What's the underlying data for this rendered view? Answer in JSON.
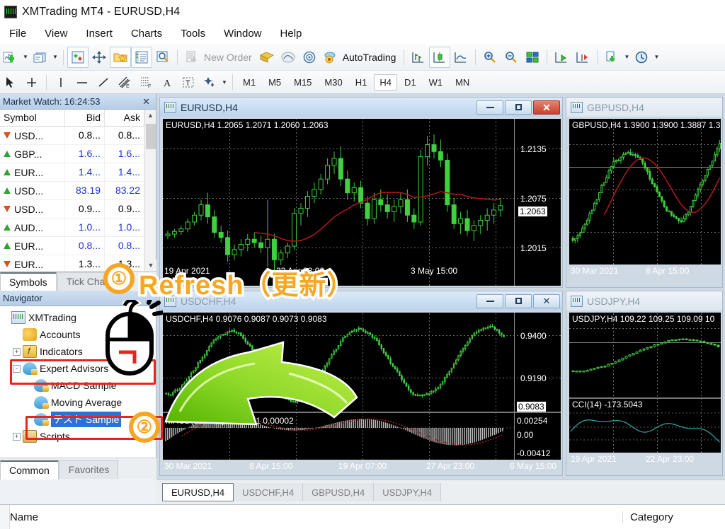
{
  "window": {
    "title": "XMTrading MT4 - EURUSD,H4",
    "app_icon": "mt4-icon"
  },
  "menu": {
    "items": [
      "File",
      "View",
      "Insert",
      "Charts",
      "Tools",
      "Window",
      "Help"
    ]
  },
  "toolbar": {
    "new_order_label": "New Order",
    "autotrading_label": "AutoTrading",
    "icons": [
      "new-chart-icon",
      "profiles-icon",
      "indicators-icon",
      "crosshair-icon",
      "favorites-icon",
      "market-watch-icon",
      "data-window-icon",
      "new-order-icon",
      "terminal-icon",
      "strategy-tester-icon",
      "metaeditor-icon",
      "autotrading-icon",
      "bar-chart-icon",
      "candlestick-chart-icon",
      "line-chart-icon",
      "zoom-in-icon",
      "zoom-out-icon",
      "tile-windows-icon",
      "chart-shift-icon",
      "auto-scroll-icon",
      "templates-icon",
      "period-icon"
    ],
    "line_tools": [
      "cursor-icon",
      "crosshair-icon",
      "vertical-line-icon",
      "horizontal-line-icon",
      "trendline-icon",
      "equidistant-channel-icon",
      "fibonacci-retracement-icon",
      "text-icon",
      "text-label-icon",
      "shapes-icon"
    ]
  },
  "timeframes": {
    "items": [
      "M1",
      "M5",
      "M15",
      "M30",
      "H1",
      "H4",
      "D1",
      "W1",
      "MN"
    ],
    "active": "H4"
  },
  "market_watch": {
    "title": "Market Watch: 16:24:53",
    "columns": [
      "Symbol",
      "Bid",
      "Ask"
    ],
    "rows": [
      {
        "dir": "down",
        "symbol": "USD...",
        "bid": "0.8...",
        "ask": "0.8...",
        "color": "down"
      },
      {
        "dir": "up",
        "symbol": "GBP...",
        "bid": "1.6...",
        "ask": "1.6...",
        "color": "up"
      },
      {
        "dir": "up",
        "symbol": "EUR...",
        "bid": "1.4...",
        "ask": "1.4...",
        "color": "up"
      },
      {
        "dir": "up",
        "symbol": "USD...",
        "bid": "83.19",
        "ask": "83.22",
        "color": "up"
      },
      {
        "dir": "down",
        "symbol": "USD...",
        "bid": "0.9...",
        "ask": "0.9...",
        "color": "down"
      },
      {
        "dir": "up",
        "symbol": "AUD...",
        "bid": "1.0...",
        "ask": "1.0...",
        "color": "up"
      },
      {
        "dir": "up",
        "symbol": "EUR...",
        "bid": "0.8...",
        "ask": "0.8...",
        "color": "up"
      },
      {
        "dir": "down",
        "symbol": "EUR...",
        "bid": "1.3...",
        "ask": "1.3...",
        "color": "down"
      }
    ],
    "tabs": [
      "Symbols",
      "Tick Chart"
    ],
    "active_tab": "Symbols",
    "close_icon": "close-icon"
  },
  "navigator": {
    "title": "Navigator",
    "tree": [
      {
        "label": "XMTrading",
        "icon": "xmtrading-icon",
        "depth": 0,
        "expander": ""
      },
      {
        "label": "Accounts",
        "icon": "accounts-icon",
        "depth": 1,
        "expander": ""
      },
      {
        "label": "Indicators",
        "icon": "indicators-icon",
        "depth": 1,
        "expander": "+"
      },
      {
        "label": "Expert Advisors",
        "icon": "expert-advisor-icon",
        "depth": 1,
        "expander": "-"
      },
      {
        "label": "MACD Sample",
        "icon": "expert-advisor-icon",
        "depth": 2,
        "expander": ""
      },
      {
        "label": "Moving Average",
        "icon": "expert-advisor-icon",
        "depth": 2,
        "expander": ""
      },
      {
        "label": "テスト Sample",
        "icon": "expert-advisor-icon",
        "depth": 2,
        "expander": "",
        "selected": true
      },
      {
        "label": "Scripts",
        "icon": "scripts-icon",
        "depth": 1,
        "expander": "+"
      }
    ],
    "tabs": [
      "Common",
      "Favorites"
    ],
    "active_tab": "Common"
  },
  "charts": [
    {
      "id": "eurusd",
      "title": "EURUSD,H4",
      "active": true,
      "ohlc": "EURUSD,H4  1.2065 1.2071 1.2060 1.2063",
      "price_labels": [
        "1.2135",
        "1.2075",
        "1.2015"
      ],
      "current_price": "1.2063",
      "time_labels": [
        "19 Apr 2021",
        "23 Apr 23:00",
        "3 May 15:00"
      ],
      "buttons": {
        "minimize": "minimize-icon",
        "maximize": "maximize-icon",
        "close": "close-icon"
      }
    },
    {
      "id": "gbpusd",
      "title": "GBPUSD,H4",
      "active": false,
      "ohlc": "GBPUSD,H4  1.3900 1.3900 1.3887 1.3",
      "price_labels": [],
      "current_price": "",
      "time_labels": [
        "30 Mar 2021",
        "8 Apr 15:00"
      ],
      "buttons": {}
    },
    {
      "id": "usdchf",
      "title": "USDCHF,H4",
      "active": false,
      "ohlc": "USDCHF,H4  0.9076 0.9087 0.9073 0.9083",
      "price_labels": [
        "0.9400",
        "0.9190"
      ],
      "current_price": "0.9083",
      "indicator": "MACD(12,26,9) -0.00081 0.00002",
      "indicator_labels": [
        "0.00254",
        "0.00",
        "-0.00412"
      ],
      "time_labels": [
        "30 Mar 2021",
        "8 Apr 15:00",
        "19 Apr 07:00",
        "27 Apr 23:00",
        "6 May 15:00"
      ],
      "buttons": {
        "minimize": "minimize-icon",
        "maximize": "maximize-icon",
        "close": "close-icon"
      }
    },
    {
      "id": "usdjpy",
      "title": "USDJPY,H4",
      "active": false,
      "ohlc": "USDJPY,H4  109.22 109.25 109.09 10",
      "price_labels": [],
      "current_price": "",
      "indicator": "CCI(14) -173.5043",
      "time_labels": [
        "19 Apr 2021",
        "22 Apr 23:00"
      ],
      "buttons": {}
    }
  ],
  "chart_tabs": {
    "items": [
      "EURUSD,H4",
      "USDCHF,H4",
      "GBPUSD,H4",
      "USDJPY,H4"
    ],
    "active": "EURUSD,H4"
  },
  "terminal": {
    "columns": [
      "Name",
      "Category"
    ]
  },
  "annotations": {
    "step1_badge": "①",
    "step1_text": "Refresh（更新）",
    "step2_badge": "②",
    "mouse_icon": "right-click-mouse-icon",
    "arrow_icon": "green-arrow-icon",
    "accent_color": "#f5a623",
    "highlight_color": "#e8241c"
  },
  "chart_data": {
    "type": "candlestick",
    "title": "EURUSD,H4",
    "ylim": [
      1.1985,
      1.2165
    ],
    "ytick_labels": [
      "1.2135",
      "1.2075",
      "1.2015"
    ],
    "xtick_labels": [
      "19 Apr 2021",
      "23 Apr 23:00",
      "3 May 15:00"
    ],
    "last_price": 1.2063,
    "ohlc": {
      "open": 1.2065,
      "high": 1.2071,
      "low": 1.206,
      "close": 1.2063
    },
    "candles": [
      [
        1.2028,
        1.2034,
        1.2024,
        1.203
      ],
      [
        1.203,
        1.2036,
        1.2026,
        1.2033
      ],
      [
        1.2033,
        1.204,
        1.2029,
        1.2036
      ],
      [
        1.2036,
        1.2048,
        1.2032,
        1.2044
      ],
      [
        1.2044,
        1.2056,
        1.204,
        1.2052
      ],
      [
        1.2052,
        1.207,
        1.2046,
        1.2064
      ],
      [
        1.2064,
        1.2078,
        1.2042,
        1.205
      ],
      [
        1.205,
        1.2058,
        1.2026,
        1.2032
      ],
      [
        1.2032,
        1.204,
        1.202,
        1.2026
      ],
      [
        1.2026,
        1.2034,
        1.1998,
        1.2006
      ],
      [
        1.2006,
        1.2018,
        1.2,
        1.2012
      ],
      [
        1.2012,
        1.2024,
        1.2004,
        1.2018
      ],
      [
        1.2018,
        1.203,
        1.201,
        1.2024
      ],
      [
        1.2024,
        1.2032,
        1.2014,
        1.202
      ],
      [
        1.202,
        1.2028,
        1.2008,
        1.2014
      ],
      [
        1.2014,
        1.207,
        1.1992,
        1.2024
      ],
      [
        1.2024,
        1.203,
        1.1988,
        1.2
      ],
      [
        1.2,
        1.2012,
        1.1994,
        1.2008
      ],
      [
        1.2008,
        1.202,
        1.2002,
        1.2016
      ],
      [
        1.2016,
        1.206,
        1.2012,
        1.2054
      ],
      [
        1.2054,
        1.2066,
        1.204,
        1.206
      ],
      [
        1.206,
        1.208,
        1.205,
        1.2074
      ],
      [
        1.2074,
        1.209,
        1.2066,
        1.2082
      ],
      [
        1.2082,
        1.21,
        1.2076,
        1.2094
      ],
      [
        1.2094,
        1.2118,
        1.2088,
        1.211
      ],
      [
        1.211,
        1.2126,
        1.21,
        1.2118
      ],
      [
        1.2118,
        1.2132,
        1.2086,
        1.2094
      ],
      [
        1.2094,
        1.2104,
        1.207,
        1.2078
      ],
      [
        1.2078,
        1.209,
        1.2068,
        1.2084
      ],
      [
        1.2084,
        1.2092,
        1.206,
        1.2066
      ],
      [
        1.2066,
        1.2074,
        1.204,
        1.2048
      ],
      [
        1.2048,
        1.2078,
        1.2042,
        1.207
      ],
      [
        1.207,
        1.2082,
        1.2056,
        1.2064
      ],
      [
        1.2064,
        1.2076,
        1.2048,
        1.2056
      ],
      [
        1.2056,
        1.207,
        1.2044,
        1.2062
      ],
      [
        1.2062,
        1.2078,
        1.2054,
        1.207
      ],
      [
        1.207,
        1.2082,
        1.2044,
        1.2052
      ],
      [
        1.2052,
        1.206,
        1.2036,
        1.2044
      ],
      [
        1.2044,
        1.2128,
        1.204,
        1.212
      ],
      [
        1.212,
        1.2144,
        1.211,
        1.2134
      ],
      [
        1.2134,
        1.2146,
        1.2118,
        1.2126
      ],
      [
        1.2126,
        1.214,
        1.2108,
        1.2116
      ],
      [
        1.2116,
        1.2124,
        1.2056,
        1.2064
      ],
      [
        1.2064,
        1.2072,
        1.2036,
        1.2042
      ],
      [
        1.2042,
        1.2056,
        1.203,
        1.2048
      ],
      [
        1.2048,
        1.2058,
        1.2028,
        1.2034
      ],
      [
        1.2034,
        1.2046,
        1.2022,
        1.204
      ],
      [
        1.204,
        1.2052,
        1.203,
        1.2046
      ],
      [
        1.2046,
        1.206,
        1.2034,
        1.2052
      ],
      [
        1.2052,
        1.2066,
        1.2042,
        1.2058
      ],
      [
        1.2058,
        1.2072,
        1.205,
        1.2063
      ]
    ]
  }
}
